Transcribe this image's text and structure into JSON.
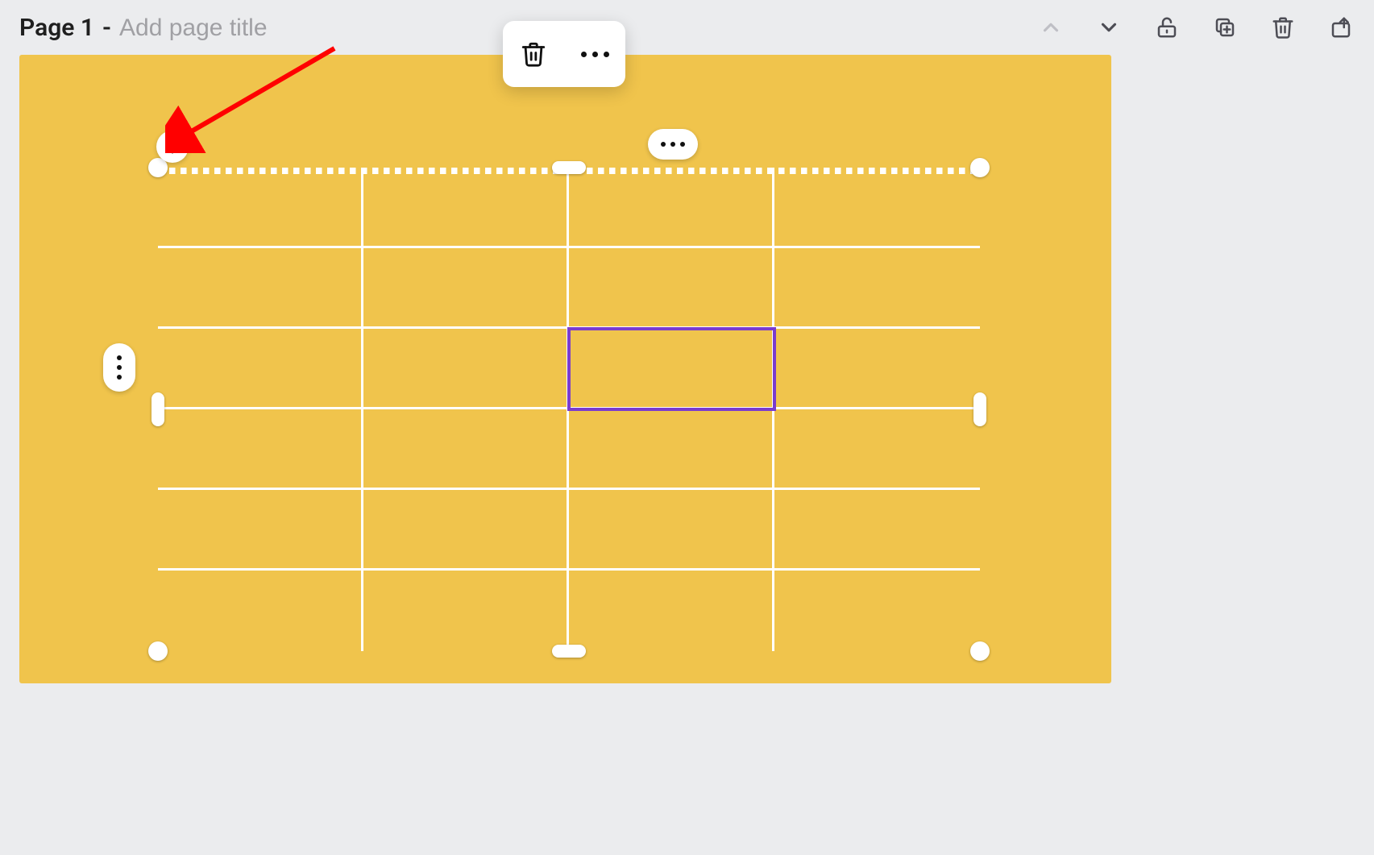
{
  "header": {
    "page_label": "Page 1",
    "separator": "-",
    "title_placeholder": "Add page title",
    "title_value": ""
  },
  "toolbar": {
    "delete": "Delete",
    "more": "More"
  },
  "top_icons": {
    "up": "chevron-up",
    "down": "chevron-down",
    "lock": "unlock",
    "duplicate": "duplicate",
    "trash": "trash",
    "share": "share"
  },
  "table": {
    "columns": 4,
    "rows": 6,
    "selected_cell": {
      "row": 3,
      "col": 3
    },
    "add_label": "+",
    "col_opts": "...",
    "row_opts": "..."
  },
  "colors": {
    "canvas": "#f0c44c",
    "selection": "#7a3cce",
    "annotation": "#ff0000"
  }
}
